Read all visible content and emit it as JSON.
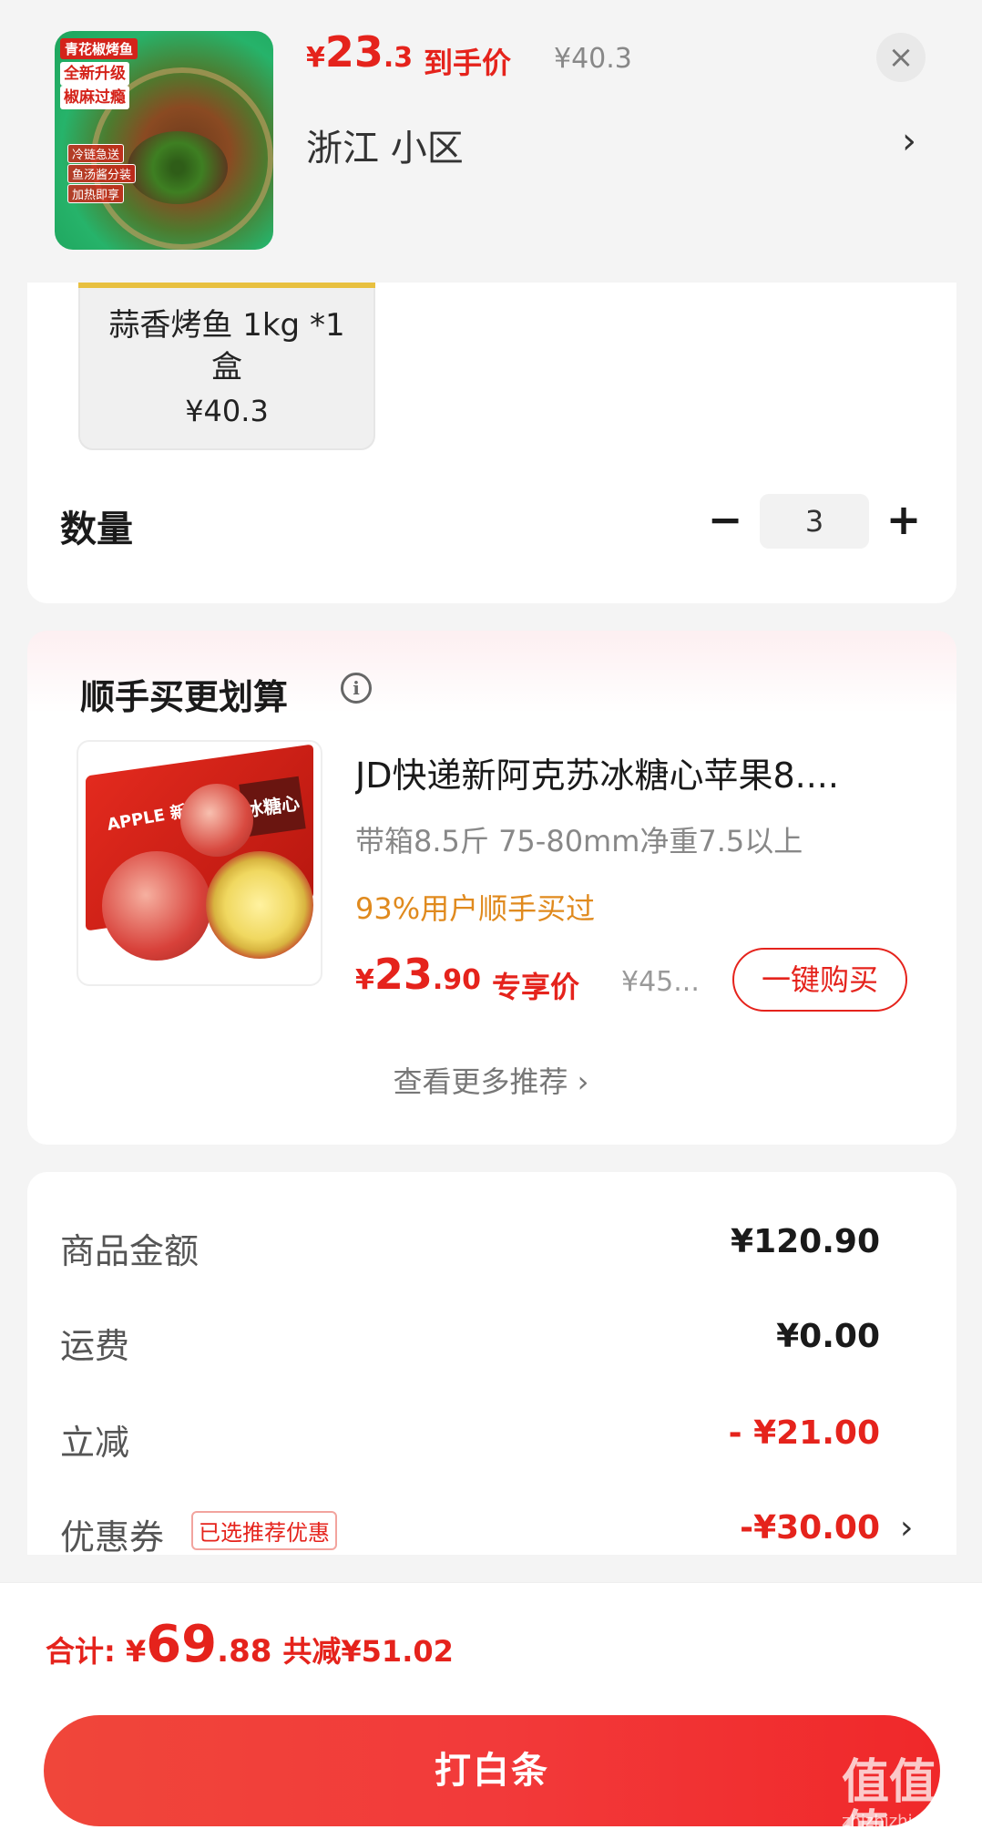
{
  "header": {
    "price_symbol": "¥",
    "price_int": "23",
    "price_dec": ".3",
    "price_label": "到手价",
    "original_price": "¥40.3",
    "close_icon": "×",
    "address": "浙江  小区",
    "address_arrow": "›",
    "thumb_tags": [
      "青花椒烤鱼",
      "全新升级",
      "椒麻过瘾",
      "冷链急送",
      "鱼汤酱分装",
      "加热即享"
    ]
  },
  "spec": {
    "name": "蒜香烤鱼 1kg *1盒",
    "price": "¥40.3"
  },
  "quantity": {
    "label": "数量",
    "minus": "−",
    "value": "3",
    "plus": "+"
  },
  "recommend": {
    "title": "顺手买更划算",
    "info_icon": "i",
    "product": {
      "title": "JD快递新阿克苏冰糖心苹果8....",
      "subtitle": "带箱8.5斤 75-80mm净重7.5以上",
      "social": "93%用户顺手买过",
      "price_symbol": "¥",
      "price_int": "23",
      "price_dec": ".90",
      "price_label": "专享价",
      "original_price": "¥45...",
      "buy_label": "一键购买",
      "box_text": "APPLE 新疆冰糖心苹果",
      "box_label": "冰糖心"
    },
    "more_label": "查看更多推荐 ›"
  },
  "summary": {
    "rows": [
      {
        "label": "商品金额",
        "value": "¥120.90"
      },
      {
        "label": "运费",
        "value": "¥0.00"
      },
      {
        "label": "立减",
        "value": "- ¥21.00"
      },
      {
        "label": "优惠券",
        "value": "-¥30.00"
      }
    ],
    "coupon_badge": "已选推荐优惠",
    "coupon_arrow": "›"
  },
  "bottom": {
    "total_label": "合计: ",
    "total_symbol": "¥",
    "total_int": "69",
    "total_dec": ".88",
    "save_text": "共减¥51.02",
    "pay_label": "打白条",
    "watermark": "值值值",
    "watermark_sub": "zhizhizhi.com"
  },
  "colors": {
    "accent_red": "#e5231c",
    "social_orange": "#e08a1e",
    "background": "#f4f4f4"
  }
}
